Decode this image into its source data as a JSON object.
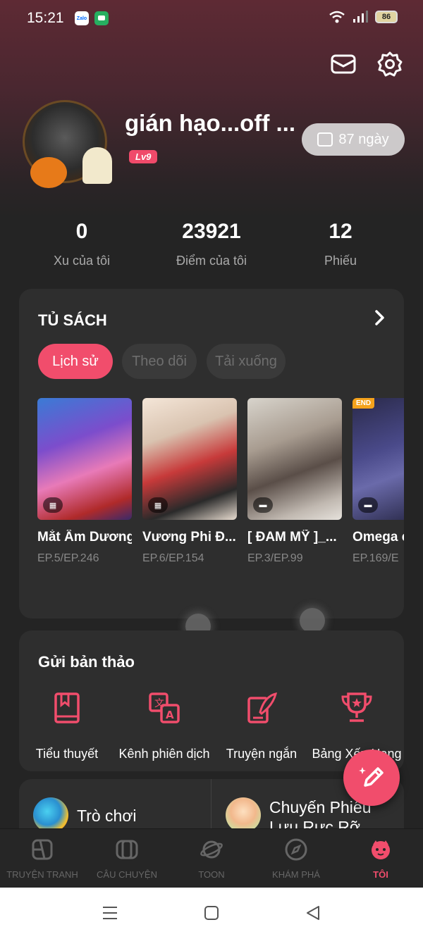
{
  "status_bar": {
    "time": "15:21",
    "apps": [
      "Zalo",
      "Messages"
    ],
    "battery": "86"
  },
  "header": {
    "mail_icon": "mail-icon",
    "settings_icon": "gear-icon"
  },
  "profile": {
    "username": "gián hạo...off ...",
    "level": "Lv9",
    "days": "87 ngày"
  },
  "stats": [
    {
      "value": "0",
      "label": "Xu của tôi"
    },
    {
      "value": "23921",
      "label": "Điểm của tôi"
    },
    {
      "value": "12",
      "label": "Phiếu"
    }
  ],
  "bookshelf": {
    "title": "TỦ SÁCH",
    "tabs": [
      {
        "label": "Lịch sử",
        "active": true
      },
      {
        "label": "Theo dõi",
        "active": false
      },
      {
        "label": "Tải xuống",
        "active": false
      }
    ],
    "books": [
      {
        "title": "Mắt Âm Dương...",
        "episode": "EP.5/EP.246",
        "badge": "comic",
        "end": false
      },
      {
        "title": "Vương Phi Đ...",
        "episode": "EP.6/EP.154",
        "badge": "comic",
        "end": false
      },
      {
        "title": "[ ĐAM MỸ ]_...",
        "episode": "EP.3/EP.99",
        "badge": "chat",
        "end": false
      },
      {
        "title": "Omega c",
        "episode": "EP.169/E",
        "badge": "chat",
        "end": true,
        "end_label": "END"
      }
    ]
  },
  "submit": {
    "title": "Gửi bản thảo",
    "tools": [
      {
        "label": "Tiểu thuyết",
        "icon": "book-icon"
      },
      {
        "label": "Kênh phiên dịch",
        "icon": "translate-icon"
      },
      {
        "label": "Truyện ngắn",
        "icon": "quill-icon"
      },
      {
        "label": "Bảng Xếp Hạng",
        "icon": "trophy-icon"
      }
    ]
  },
  "games": [
    {
      "label": "Trò chơi"
    },
    {
      "label": "Chuyến Phiêu Lưu Rực Rỡ"
    }
  ],
  "tabbar": [
    {
      "label": "TRUYỆN TRANH",
      "icon": "comic-icon",
      "active": false
    },
    {
      "label": "CÂU CHUYỆN",
      "icon": "story-icon",
      "active": false
    },
    {
      "label": "TOON",
      "icon": "planet-icon",
      "active": false
    },
    {
      "label": "KHÁM PHÁ",
      "icon": "compass-icon",
      "active": false
    },
    {
      "label": "TÔI",
      "icon": "face-icon",
      "active": true
    }
  ],
  "colors": {
    "accent": "#f14d6c",
    "background": "#242424",
    "card": "#2e2e2e"
  }
}
